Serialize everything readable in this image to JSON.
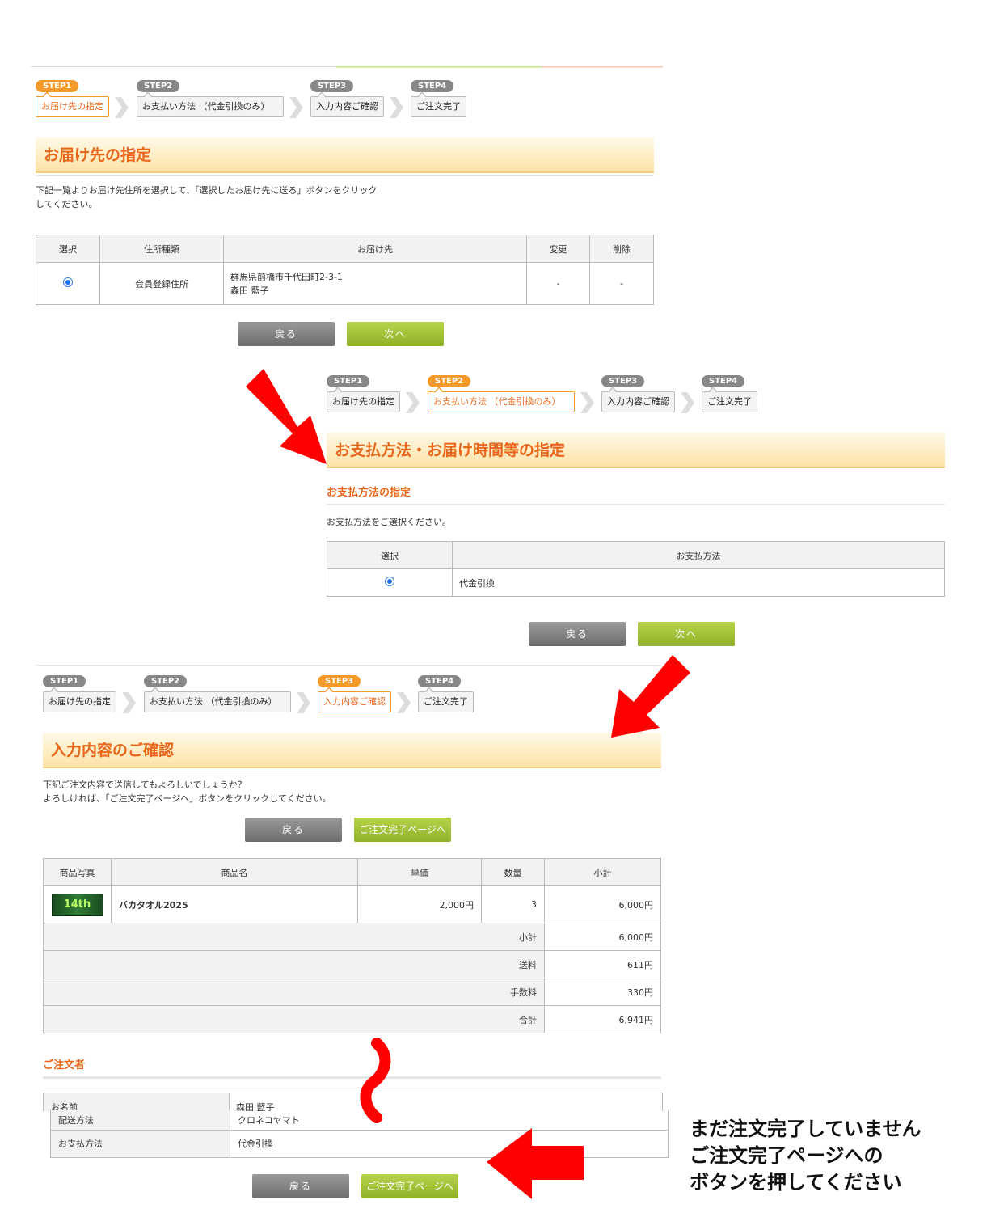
{
  "steps": [
    {
      "badge": "STEP1",
      "label": "お届け先の指定"
    },
    {
      "badge": "STEP2",
      "label": "お支払い方法 （代金引換のみ）"
    },
    {
      "badge": "STEP3",
      "label": "入力内容ご確認"
    },
    {
      "badge": "STEP4",
      "label": "ご注文完了"
    }
  ],
  "section1": {
    "title": "お届け先の指定",
    "instruction": "下記一覧よりお届け先住所を選択して、「選択したお届け先に送る」ボタンをクリック\nしてください。",
    "table": {
      "headers": [
        "選択",
        "住所種類",
        "お届け先",
        "変更",
        "削除"
      ],
      "row": {
        "type": "会員登録住所",
        "address": "群馬県前橋市千代田町2-3-1",
        "name": "森田 藍子",
        "edit": "-",
        "delete": "-"
      }
    },
    "back": "戻る",
    "next": "次へ"
  },
  "section2": {
    "title": "お支払方法・お届け時間等の指定",
    "subtitle": "お支払方法の指定",
    "instruction": "お支払方法をご選択ください。",
    "table": {
      "headers": [
        "選択",
        "お支払方法"
      ],
      "row": {
        "method": "代金引換"
      }
    },
    "back": "戻る",
    "next": "次へ"
  },
  "section3": {
    "title": "入力内容のご確認",
    "instruction": "下記ご注文内容で送信してもよろしいでしょうか？\nよろしければ、「ご注文完了ページへ」ボタンをクリックしてください。",
    "back": "戻る",
    "complete": "ご注文完了ページへ",
    "table": {
      "headers": [
        "商品写真",
        "商品名",
        "単価",
        "数量",
        "小計"
      ],
      "item": {
        "thumb": "14th",
        "name": "バカタオル2025",
        "price": "2,000円",
        "qty": "3",
        "subtotal": "6,000円"
      },
      "summary": [
        {
          "label": "小計",
          "value": "6,000円"
        },
        {
          "label": "送料",
          "value": "611円"
        },
        {
          "label": "手数料",
          "value": "330円"
        },
        {
          "label": "合計",
          "value": "6,941円"
        }
      ]
    },
    "orderer_title": "ご注文者",
    "orderer": {
      "name_label": "お名前",
      "name_value": "森田 藍子"
    },
    "delivery": [
      {
        "label": "配送方法",
        "value": "クロネコヤマト"
      },
      {
        "label": "お支払方法",
        "value": "代金引換"
      }
    ],
    "back2": "戻る",
    "complete2": "ご注文完了ページへ"
  },
  "note": {
    "line1": "まだ注文完了していません",
    "line2": "ご注文完了ページへの",
    "line3": "ボタンを押してください"
  },
  "colors": {
    "accent": "#e8661a",
    "step_active": "#f39a2b",
    "arrow": "#ff0000",
    "button_green": "#9fbf33"
  }
}
